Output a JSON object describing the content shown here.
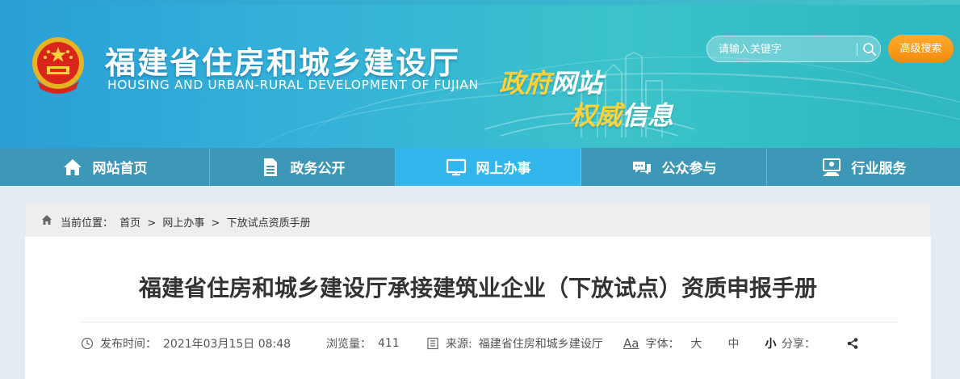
{
  "header": {
    "title": "福建省住房和城乡建设厅",
    "subtitle": "HOUSING AND URBAN-RURAL DEVELOPMENT OF FUJIAN",
    "slogan_line1_gold": "政府",
    "slogan_line1_white": "网站",
    "slogan_line2_gold": "权威",
    "slogan_line2_white": "信息",
    "search_placeholder": "请输入关键字",
    "advanced_search": "高级搜索"
  },
  "nav": {
    "items": [
      {
        "label": "网站首页",
        "icon": "home-icon"
      },
      {
        "label": "政务公开",
        "icon": "document-icon"
      },
      {
        "label": "网上办事",
        "icon": "monitor-icon"
      },
      {
        "label": "公众参与",
        "icon": "chat-icon"
      },
      {
        "label": "行业服务",
        "icon": "service-icon"
      }
    ],
    "active": "网上办事"
  },
  "breadcrumb": {
    "prefix": "当前位置：",
    "items": [
      "首页",
      ">",
      "网上办事",
      ">",
      "下放试点资质手册"
    ]
  },
  "article": {
    "title": "福建省住房和城乡建设厅承接建筑业企业（下放试点）资质申报手册",
    "publish_label": "发布时间：",
    "publish_time": "2021年03月15日 08:48",
    "views_label": "浏览量：",
    "views": "411",
    "source_label": "来源:",
    "source": "福建省住房和城乡建设厅",
    "aa": "Aa",
    "font_label": "字体：",
    "font_large": "大",
    "font_medium": "中",
    "font_small": "小",
    "share_label": "分享："
  },
  "colors": {
    "header_gradient": [
      "#2a9fd6",
      "#3bc3c9"
    ],
    "nav_bg": "#3d98b8",
    "nav_active": "#33b6ec",
    "adv_search": "#f58a0a",
    "gold": "#ffd23a"
  }
}
